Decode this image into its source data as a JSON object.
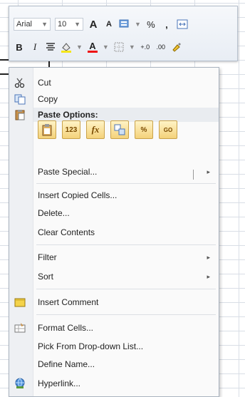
{
  "toolbar": {
    "font_name": "Arial",
    "font_size": "10",
    "grow_font": "A",
    "shrink_font": "A",
    "percent": "%",
    "comma": ",",
    "bold": "B",
    "italic": "I",
    "font_color": "A",
    "increase_decimal": "+.0",
    "decrease_decimal": ".00"
  },
  "menu": {
    "cut": "Cut",
    "copy": "Copy",
    "paste_options_header": "Paste Options:",
    "paste_buttons": [
      "",
      "123",
      "fx",
      "",
      "%",
      "GO"
    ],
    "paste_special": "Paste Special...",
    "insert_copied_cells": "Insert Copied Cells...",
    "delete": "Delete...",
    "clear_contents": "Clear Contents",
    "filter": "Filter",
    "sort": "Sort",
    "insert_comment": "Insert Comment",
    "format_cells": "Format Cells...",
    "pick_from_list": "Pick From Drop-down List...",
    "define_name": "Define Name...",
    "hyperlink": "Hyperlink...",
    "submenu_arrow": "▸"
  },
  "icons": {
    "cut": "scissors-icon",
    "copy": "copy-icon",
    "paste": "clipboard-icon",
    "insert_comment": "comment-icon",
    "format_cells": "format-cells-icon",
    "hyperlink": "hyperlink-icon"
  }
}
